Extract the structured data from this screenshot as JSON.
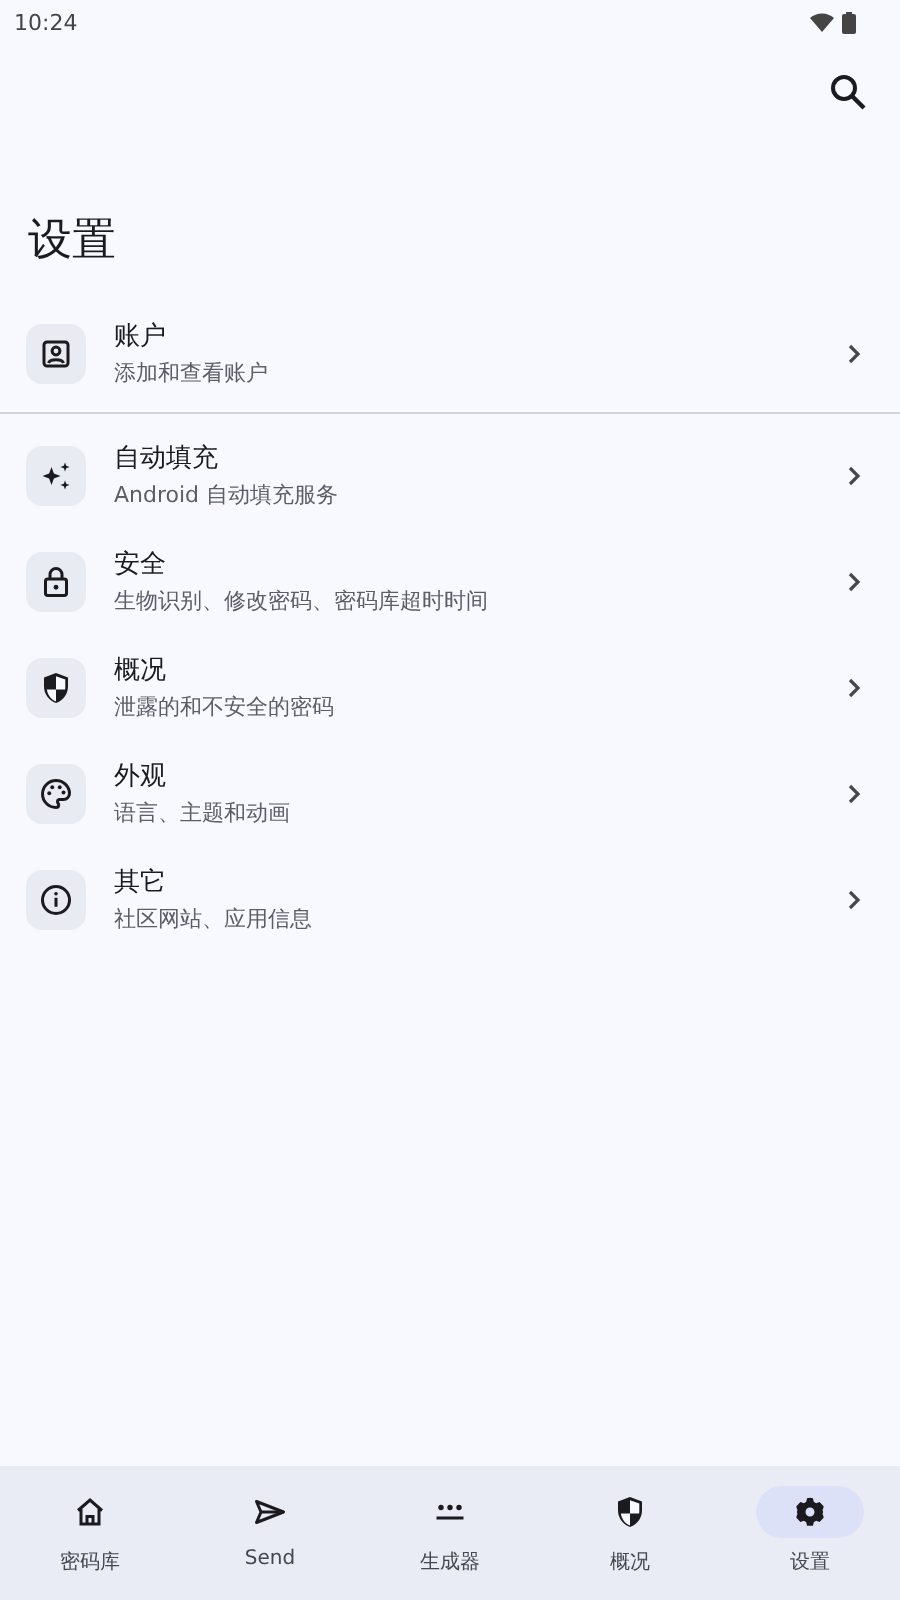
{
  "status_bar": {
    "time": "10:24"
  },
  "title": "设置",
  "items": [
    {
      "kind": "account",
      "title": "账户",
      "subtitle": "添加和查看账户",
      "divider_after": true
    },
    {
      "kind": "autofill",
      "title": "自动填充",
      "subtitle": "Android 自动填充服务",
      "divider_after": false
    },
    {
      "kind": "lock",
      "title": "安全",
      "subtitle": "生物识别、修改密码、密码库超时时间",
      "divider_after": false
    },
    {
      "kind": "shield",
      "title": "概况",
      "subtitle": "泄露的和不安全的密码",
      "divider_after": false
    },
    {
      "kind": "palette",
      "title": "外观",
      "subtitle": "语言、主题和动画",
      "divider_after": false
    },
    {
      "kind": "info",
      "title": "其它",
      "subtitle": "社区网站、应用信息",
      "divider_after": false
    }
  ],
  "nav": [
    {
      "kind": "home",
      "label": "密码库",
      "selected": false
    },
    {
      "kind": "send",
      "label": "Send",
      "selected": false
    },
    {
      "kind": "generator",
      "label": "生成器",
      "selected": false
    },
    {
      "kind": "shield",
      "label": "概况",
      "selected": false
    },
    {
      "kind": "gear",
      "label": "设置",
      "selected": true
    }
  ]
}
